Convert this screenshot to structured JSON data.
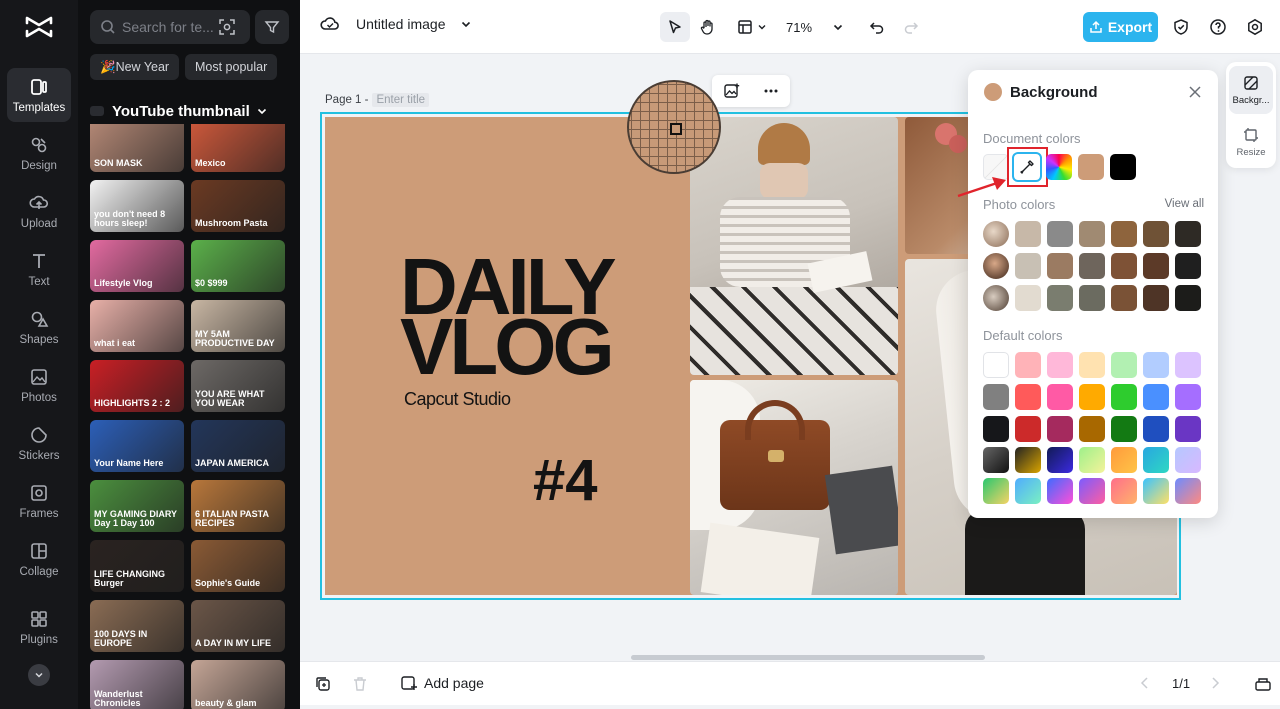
{
  "sidebar": {
    "items": [
      {
        "label": "Templates",
        "icon": "templates-icon"
      },
      {
        "label": "Design",
        "icon": "design-icon"
      },
      {
        "label": "Upload",
        "icon": "upload-icon"
      },
      {
        "label": "Text",
        "icon": "text-icon"
      },
      {
        "label": "Shapes",
        "icon": "shapes-icon"
      },
      {
        "label": "Photos",
        "icon": "photos-icon"
      },
      {
        "label": "Stickers",
        "icon": "stickers-icon"
      },
      {
        "label": "Frames",
        "icon": "frames-icon"
      },
      {
        "label": "Collage",
        "icon": "collage-icon"
      },
      {
        "label": "Plugins",
        "icon": "plugins-icon"
      }
    ]
  },
  "templates_panel": {
    "search_placeholder": "Search for te...",
    "chips": [
      "🎉New Year",
      "Most popular"
    ],
    "section_title": "YouTube thumbnail",
    "thumbs": [
      {
        "text": "SON MASK",
        "bg": "#b88b78"
      },
      {
        "text": "Mexico",
        "bg": "#d25a3c"
      },
      {
        "text": "you don't need 8 hours sleep!",
        "bg": "#f2f2f2"
      },
      {
        "text": "Mushroom Pasta",
        "bg": "#6b3a23"
      },
      {
        "text": "Lifestyle Vlog",
        "bg": "#e26aa0"
      },
      {
        "text": "$0 $999",
        "bg": "#5bb04a"
      },
      {
        "text": "what i eat",
        "bg": "#e8b0a8"
      },
      {
        "text": "MY 5AM PRODUCTIVE DAY",
        "bg": "#c8b6a3"
      },
      {
        "text": "HIGHLIGHTS 2 : 2",
        "bg": "#c91f25"
      },
      {
        "text": "YOU ARE WHAT YOU WEAR",
        "bg": "#6d6966"
      },
      {
        "text": "Your Name Here",
        "bg": "#2c5fb8"
      },
      {
        "text": "JAPAN AMERICA",
        "bg": "#23365a"
      },
      {
        "text": "MY GAMING DIARY Day 1 Day 100",
        "bg": "#4b8f3e"
      },
      {
        "text": "6 ITALIAN PASTA RECIPES",
        "bg": "#b8773b"
      },
      {
        "text": "LIFE CHANGING Burger",
        "bg": "#2a2320"
      },
      {
        "text": "Sophie's Guide",
        "bg": "#8a5a35"
      },
      {
        "text": "100 DAYS IN EUROPE",
        "bg": "#8a6c54"
      },
      {
        "text": "A DAY IN MY LIFE",
        "bg": "#6b5648"
      },
      {
        "text": "Wanderlust Chronicles",
        "bg": "#b39ab0"
      },
      {
        "text": "beauty & glam",
        "bg": "#c4a596"
      }
    ]
  },
  "topbar": {
    "doc_title": "Untitled image",
    "zoom": "71%",
    "export_label": "Export"
  },
  "canvas": {
    "page_label": "Page 1 -",
    "title_placeholder": "Enter title",
    "design": {
      "line1": "DAILY",
      "line2": "VLOG",
      "studio": "Capcut Studio",
      "number": "#4",
      "bg_color": "#cd9c78"
    }
  },
  "background_panel": {
    "title": "Background",
    "document_colors_label": "Document colors",
    "photo_colors_label": "Photo colors",
    "view_all": "View all",
    "default_colors_label": "Default colors",
    "document_colors": [
      "#f5f5f5",
      "rainbow",
      "#cd9c78",
      "#000000"
    ],
    "photo_colors": [
      [
        "#c7b8a8",
        "#8a8a8a",
        "#a08a72",
        "#8e643d",
        "#6f5236",
        "#2e2a25"
      ],
      [
        "#c8c0b4",
        "#9b7b62",
        "#6e655c",
        "#7e5236",
        "#5c3a28",
        "#1f1f1f"
      ],
      [
        "#e2dbd0",
        "#7a7d6f",
        "#6b6b60",
        "#7a5236",
        "#4e3426",
        "#1c1c1a"
      ]
    ],
    "default_colors": [
      [
        "#ffffff",
        "#ffb3b8",
        "#ffb8d9",
        "#ffe2b0",
        "#b2f0b2",
        "#b2cdff",
        "#dcc3ff"
      ],
      [
        "#808080",
        "#ff5a5a",
        "#ff5aa5",
        "#ffaa00",
        "#2ecc2e",
        "#4a90ff",
        "#a56eff"
      ],
      [
        "#16171a",
        "#cc2a2a",
        "#a52a5e",
        "#a86800",
        "#137a13",
        "#1f4fbf",
        "#6a36c4"
      ]
    ]
  },
  "right_tools": {
    "background_label": "Backgr...",
    "resize_label": "Resize"
  },
  "bottombar": {
    "add_page_label": "Add page",
    "page_counter": "1/1"
  }
}
